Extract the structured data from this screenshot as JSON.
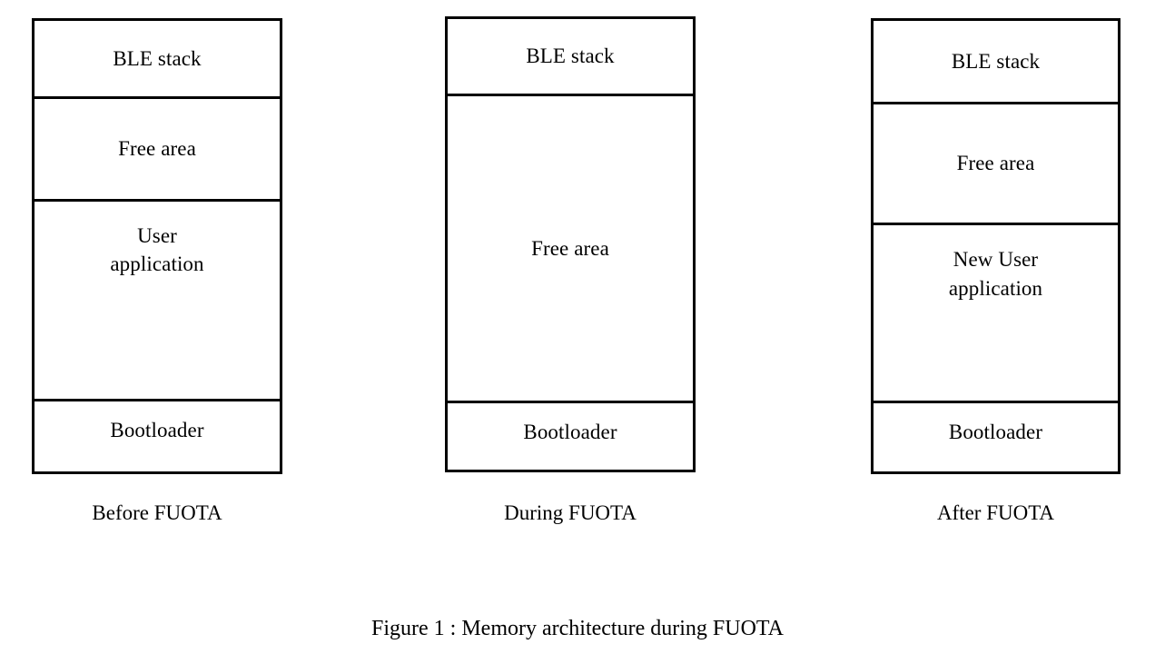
{
  "figure": {
    "caption": "Figure 1 : Memory architecture during FUOTA",
    "background_color": "#ffffff",
    "line_color": "#000000",
    "text_color": "#000000"
  },
  "diagram_data": {
    "type": "memory-layout",
    "title": "Memory architecture during FUOTA",
    "columns": [
      {
        "caption": "Before FUOTA",
        "regions": [
          {
            "label": "BLE stack"
          },
          {
            "label": "Free area"
          },
          {
            "label": "User\napplication"
          },
          {
            "label": "Bootloader"
          }
        ]
      },
      {
        "caption": "During FUOTA",
        "regions": [
          {
            "label": "BLE stack"
          },
          {
            "label": "Free area"
          },
          {
            "label": "Bootloader"
          }
        ]
      },
      {
        "caption": "After FUOTA",
        "regions": [
          {
            "label": "BLE stack"
          },
          {
            "label": "Free area"
          },
          {
            "label": "New User\napplication"
          },
          {
            "label": "Bootloader"
          }
        ]
      }
    ]
  }
}
